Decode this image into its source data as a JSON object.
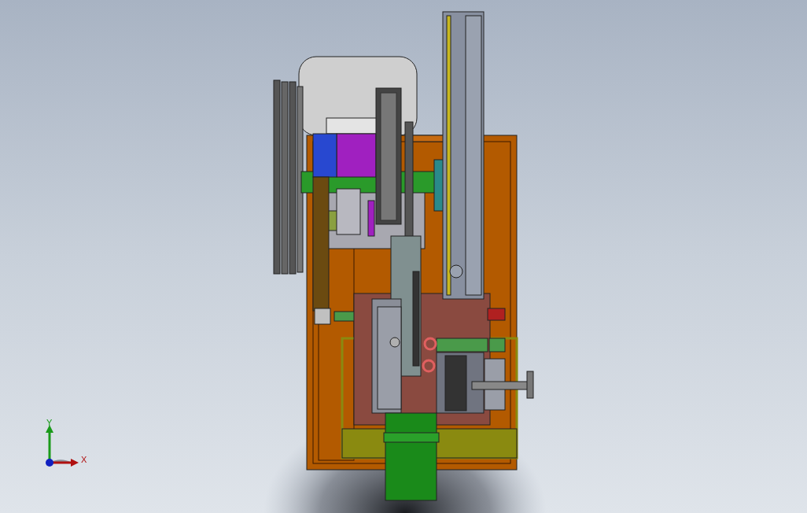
{
  "viewport": {
    "triad": {
      "axes": [
        {
          "label": "Y"
        },
        {
          "label": "X"
        }
      ]
    }
  }
}
